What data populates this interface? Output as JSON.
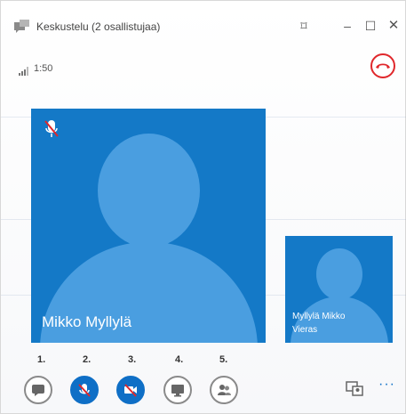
{
  "window": {
    "title": "Keskustelu (2 osallistujaa)"
  },
  "call": {
    "duration": "1:50"
  },
  "participants": {
    "main": {
      "name": "Mikko Myllylä"
    },
    "self": {
      "name": "Myllylä Mikko",
      "role": "Vieras"
    }
  },
  "controls": [
    {
      "number": "1.",
      "icon": "chat-icon",
      "active": false
    },
    {
      "number": "2.",
      "icon": "mic-muted-icon",
      "active": true
    },
    {
      "number": "3.",
      "icon": "video-off-icon",
      "active": true
    },
    {
      "number": "4.",
      "icon": "present-icon",
      "active": false
    },
    {
      "number": "5.",
      "icon": "participants-icon",
      "active": false
    }
  ],
  "colors": {
    "accent": "#0f6fc6",
    "tile": "#1479c7",
    "avatar": "#4a9ee0",
    "hangup": "#e0272b"
  },
  "more_label": "···"
}
